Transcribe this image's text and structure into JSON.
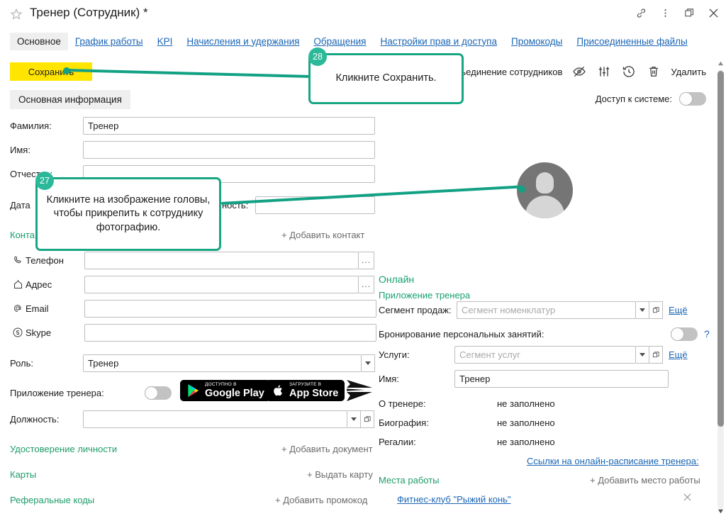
{
  "window": {
    "title": "Тренер (Сотрудник) *",
    "icons": {
      "favorite": "star-icon",
      "link": "link-icon",
      "menu": "kebab-menu-icon",
      "restore": "restore-window-icon",
      "close": "close-window-icon"
    }
  },
  "tabs": [
    {
      "label": "Основное",
      "active": true
    },
    {
      "label": "График работы",
      "active": false
    },
    {
      "label": "KPI",
      "active": false
    },
    {
      "label": "Начисления и удержания",
      "active": false
    },
    {
      "label": "Обращения",
      "active": false
    },
    {
      "label": "Настройки прав и доступа",
      "active": false
    },
    {
      "label": "Промокоды",
      "active": false
    },
    {
      "label": "Присоединенные файлы",
      "active": false
    }
  ],
  "toolbar": {
    "save_label": "Сохранить",
    "merge_label": "Объединение сотрудников",
    "delete_label": "Удалить",
    "icons": [
      "eye-off-icon",
      "settings-sliders-icon",
      "history-clock-icon",
      "trash-icon"
    ]
  },
  "section": {
    "header": "Основная информация",
    "access_label": "Доступ к системе:",
    "access_toggle": "off"
  },
  "left_form": {
    "lastname": {
      "label": "Фамилия:",
      "value": "Тренер"
    },
    "firstname": {
      "label": "Имя:",
      "value": ""
    },
    "middlename": {
      "label": "Отчество:",
      "value": ""
    },
    "birthdate": {
      "label": "Дата",
      "value": ""
    },
    "citizenship": {
      "label": "ность:",
      "value": ""
    },
    "contacts_header": "Конта",
    "add_contact": "+ Добавить контакт",
    "contacts": [
      {
        "icon": "phone-icon",
        "label": "Телефон",
        "value": "",
        "more": "..."
      },
      {
        "icon": "home-icon",
        "label": "Адрес",
        "value": "",
        "more": "..."
      },
      {
        "icon": "at-email-icon",
        "label": "Email",
        "value": ""
      },
      {
        "icon": "skype-icon",
        "label": "Skype",
        "value": ""
      }
    ],
    "role": {
      "label": "Роль:",
      "value": "Тренер"
    },
    "trainer_app": {
      "label": "Приложение тренера:",
      "toggle": "off"
    },
    "google_play": {
      "small": "ДОСТУПНО В",
      "big": "Google Play"
    },
    "app_store": {
      "small": "Загрузите в",
      "big": "App Store"
    },
    "position": {
      "label": "Должность:",
      "value": ""
    },
    "identity": {
      "label": "Удостоверение личности",
      "action": "+ Добавить документ"
    },
    "cards": {
      "label": "Карты",
      "action": "+ Выдать карту"
    },
    "referral": {
      "label": "Реферальные коды",
      "action": "+ Добавить промокод"
    }
  },
  "right_form": {
    "online_header": "Онлайн",
    "trainer_app_header": "Приложение тренера",
    "sales_segment": {
      "label": "Сегмент продаж:",
      "placeholder": "Сегмент номенклатур",
      "more": "Ещё"
    },
    "booking": {
      "label": "Бронирование персональных занятий:",
      "toggle": "off",
      "help": "?"
    },
    "services": {
      "label": "Услуги:",
      "placeholder": "Сегмент услуг",
      "more": "Ещё"
    },
    "name": {
      "label": "Имя:",
      "value": "Тренер"
    },
    "about": {
      "label": "О тренере:",
      "value": "не заполнено"
    },
    "biography": {
      "label": "Биография:",
      "value": "не заполнено"
    },
    "regalia": {
      "label": "Регалии:",
      "value": "не заполнено"
    },
    "schedule_links": "Ссылки на онлайн-расписание тренера:",
    "workplaces": {
      "label": "Места работы",
      "action": "+ Добавить место работы"
    },
    "workplace_items": [
      {
        "name": "Фитнес-клуб \"Рыжий конь\"",
        "remove": "×"
      }
    ]
  },
  "callouts": [
    {
      "number": "28",
      "text": "Кликните Сохранить."
    },
    {
      "number": "27",
      "text": "Кликните на изображение головы, чтобы прикрепить к сотруднику фотографию."
    }
  ],
  "colors": {
    "accent_green": "#13a184",
    "badge_green": "#2cb999",
    "save_yellow": "#ffe500",
    "link_blue": "#1b66b5",
    "green_text": "#16a06c"
  }
}
